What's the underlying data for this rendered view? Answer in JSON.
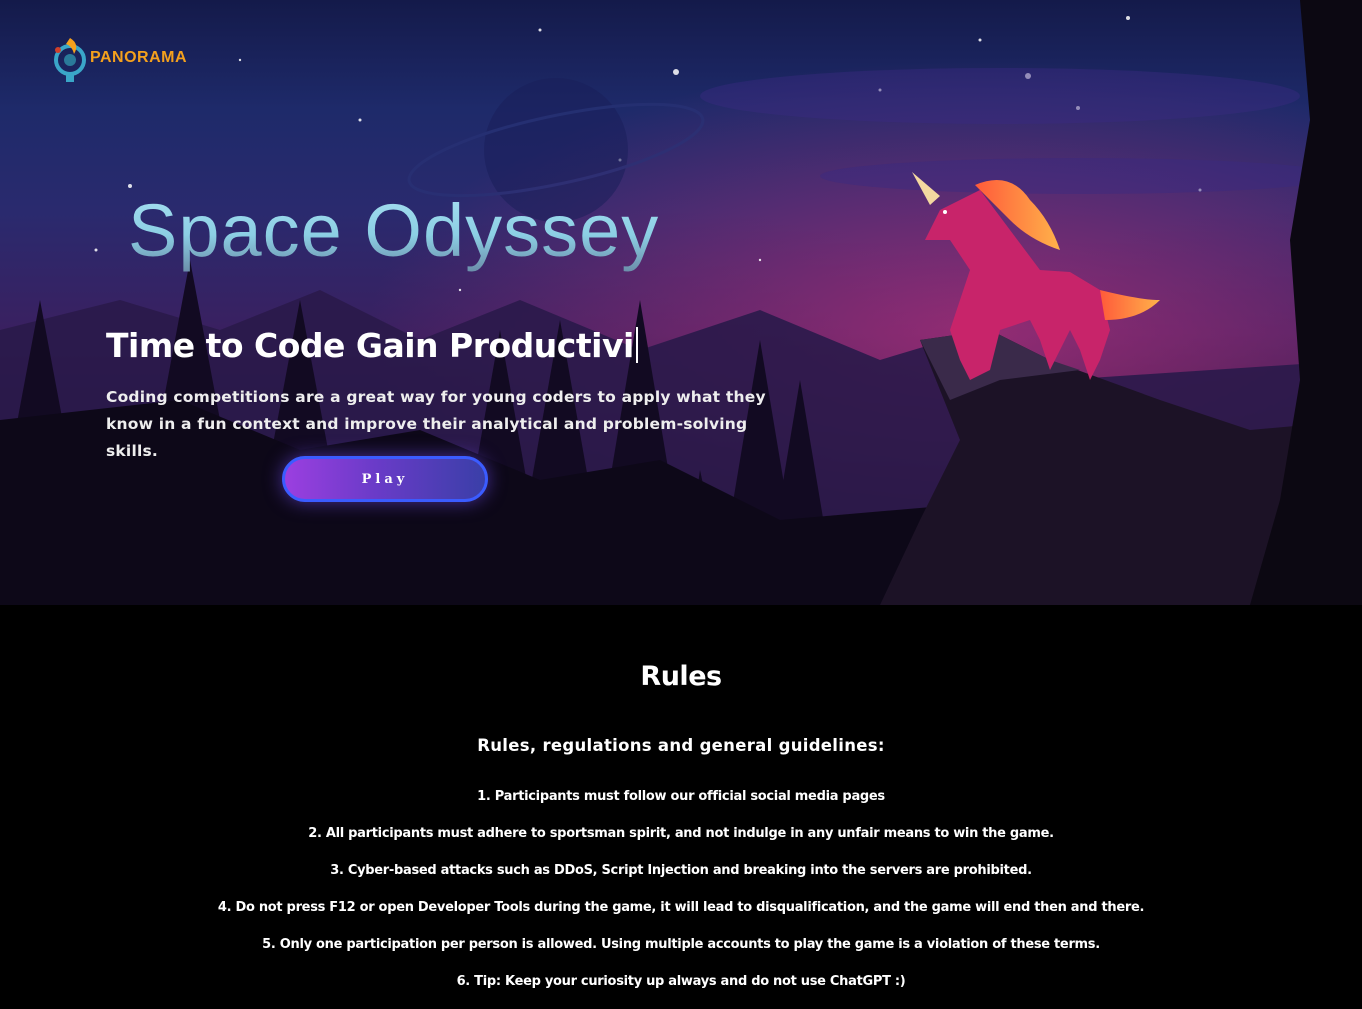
{
  "brand": {
    "logo_text": "PANORAMA",
    "logo_icon": "panorama-logo-icon"
  },
  "hero": {
    "title": "Space Odyssey",
    "typed_text": "Time to Code Gain Productivi",
    "description": "Coding competitions are a great way for young coders to apply what they know in a fun context and improve their analytical and problem-solving skills.",
    "play_label": "Play"
  },
  "rules": {
    "title": "Rules",
    "subtitle": "Rules, regulations and general guidelines:",
    "items": [
      "1. Participants must follow our official social media pages",
      "2. All participants must adhere to sportsman spirit, and not indulge in any unfair means to win the game.",
      "3. Cyber-based attacks such as DDoS, Script Injection and breaking into the servers are prohibited.",
      "4. Do not press F12 or open Developer Tools during the game, it will lead to disqualification, and the game will end then and there.",
      "5. Only one participation per person is allowed. Using multiple accounts to play the game is a violation of these terms.",
      "6. Tip: Keep your curiosity up always and do not use ChatGPT :)"
    ]
  },
  "colors": {
    "title_gradient_top": "#a8e0f2",
    "logo_orange": "#f4a11d",
    "button_purple": "#9b3fe0",
    "button_border": "#3b5cff",
    "unicorn_body": "#c8246a",
    "unicorn_mane": "#ff8a3a"
  }
}
